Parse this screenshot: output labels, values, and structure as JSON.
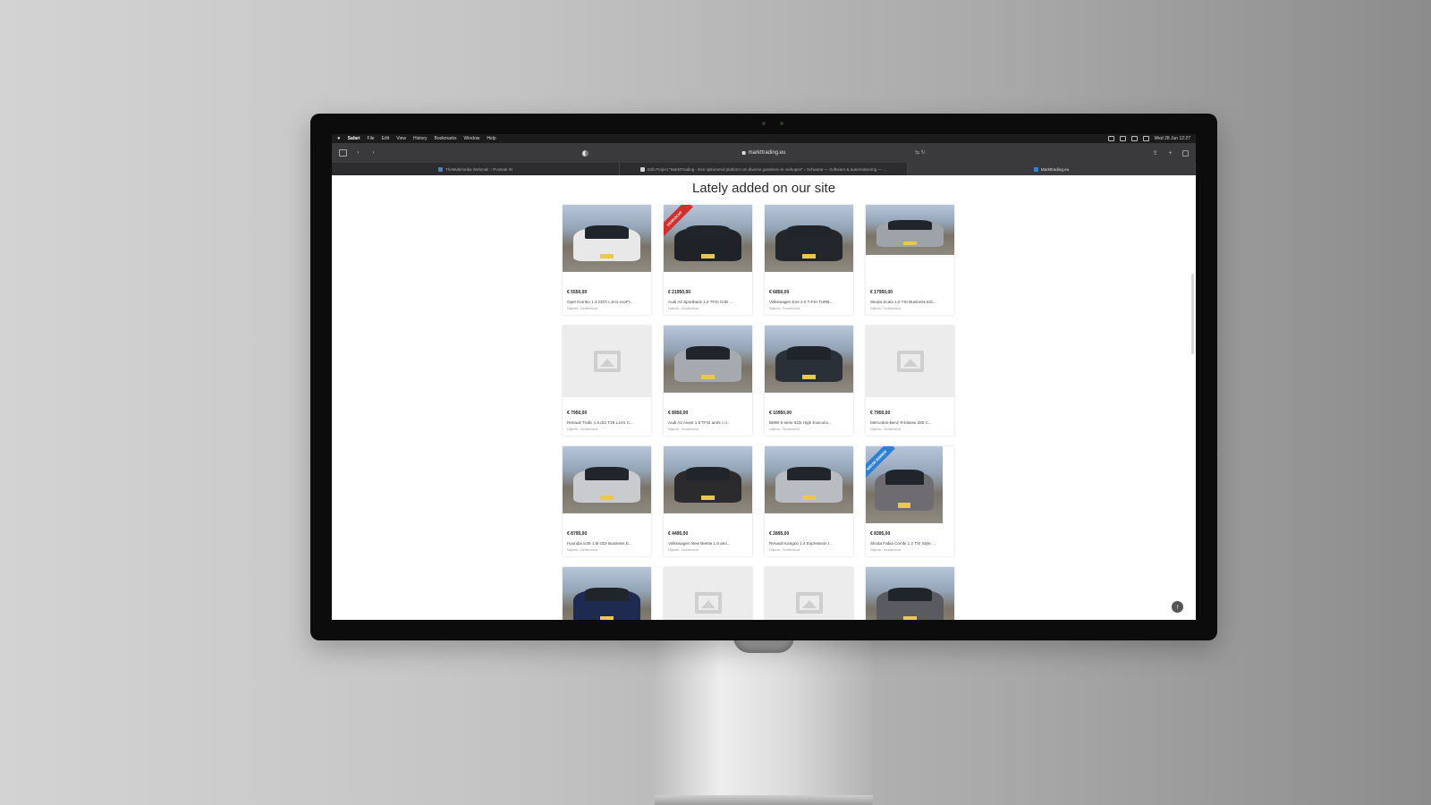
{
  "menubar": {
    "app": "Safari",
    "items": [
      "File",
      "Edit",
      "View",
      "History",
      "Bookmarks",
      "Window",
      "Help"
    ],
    "clock": "Wed 28 Jun 12:27"
  },
  "browser": {
    "url": "markttrading.eu",
    "tabs": [
      {
        "label": "TheMultimedia Webmail :: Postvak IN",
        "active": false
      },
      {
        "label": "Edit Project \"MarktTrading - Een opkomend platform om diverse goederen te verkopen\" ‹ Schwane — Software & automatisering — ...",
        "active": false
      },
      {
        "label": "Markttrading.eu",
        "active": true
      }
    ]
  },
  "page": {
    "title": "Lately added on our site"
  },
  "listings": [
    {
      "price": "€ 5550,00",
      "name": "Opel Combo 1.3 CDTi L1H1 ecoFl...",
      "location": "Nijkerk, Gelderland",
      "image": "photo",
      "car_color": "#e8e8e8",
      "ribbon": ""
    },
    {
      "price": "€ 21950,00",
      "name": "Audi A3 Sportback 1.4 TFSI CoD ...",
      "location": "Nijkerk, Gelderland",
      "image": "photo",
      "car_color": "#1f2226",
      "ribbon": "VERKOCHT"
    },
    {
      "price": "€ 6850,00",
      "name": "Volkswagen Eos 2.0 T-FSI TURB...",
      "location": "Nijkerk, Gelderland",
      "image": "photo",
      "car_color": "#23262b",
      "ribbon": ""
    },
    {
      "price": "€ 17950,00",
      "name": "Skoda Scala 1.0 TSI Business Edi...",
      "location": "Nijkerk, Gelderland",
      "image": "photo-short",
      "car_color": "#9ea3a8",
      "ribbon": ""
    },
    {
      "price": "€ 7950,00",
      "name": "Renault Trafic 1.6 dCi T29 L1H1 C...",
      "location": "Nijkerk, Gelderland",
      "image": "placeholder",
      "car_color": "",
      "ribbon": ""
    },
    {
      "price": "€ 8950,00",
      "name": "Audi A4 Avant 1.8 TFSI ambi / ci...",
      "location": "Nijkerk, Gelderland",
      "image": "photo",
      "car_color": "#a6a9ad",
      "ribbon": ""
    },
    {
      "price": "€ 10950,00",
      "name": "BMW 5-serie 523i High Executiv...",
      "location": "Nijkerk, Gelderland",
      "image": "photo",
      "car_color": "#2a3038",
      "ribbon": ""
    },
    {
      "price": "€ 7950,00",
      "name": "Mercedes-Benz R-klasse 280 C...",
      "location": "Nijkerk, Gelderland",
      "image": "placeholder",
      "car_color": "",
      "ribbon": ""
    },
    {
      "price": "€ 8795,00",
      "name": "Hyundai ix35 1.6i GDI Business E...",
      "location": "Nijkerk, Gelderland",
      "image": "photo",
      "car_color": "#c9cbce",
      "ribbon": ""
    },
    {
      "price": "€ 4495,00",
      "name": "Volkswagen New Beetle 1.6 ami...",
      "location": "Nijkerk, Gelderland",
      "image": "photo",
      "car_color": "#2b2b2d",
      "ribbon": ""
    },
    {
      "price": "€ 2895,00",
      "name": "Renault Kangoo 1.4 Expression I...",
      "location": "Nijkerk, Gelderland",
      "image": "photo",
      "car_color": "#b9bcc0",
      "ribbon": ""
    },
    {
      "price": "€ 8395,00",
      "name": "Skoda Fabia Combi 1.2 TSI Style ...",
      "location": "Nijkerk, Gelderland",
      "image": "photo-mid",
      "car_color": "#6e6c70",
      "ribbon": "NIEUW BINNEN"
    },
    {
      "price": "",
      "name": "",
      "location": "",
      "image": "photo",
      "car_color": "#1e2a4f",
      "ribbon": ""
    },
    {
      "price": "",
      "name": "",
      "location": "",
      "image": "placeholder",
      "car_color": "",
      "ribbon": ""
    },
    {
      "price": "",
      "name": "",
      "location": "",
      "image": "placeholder",
      "car_color": "",
      "ribbon": ""
    },
    {
      "price": "",
      "name": "",
      "location": "",
      "image": "photo",
      "car_color": "#5a5b60",
      "ribbon": ""
    }
  ],
  "icons": {
    "apple": "apple-icon",
    "scroll_top": "arrow-up-icon"
  }
}
